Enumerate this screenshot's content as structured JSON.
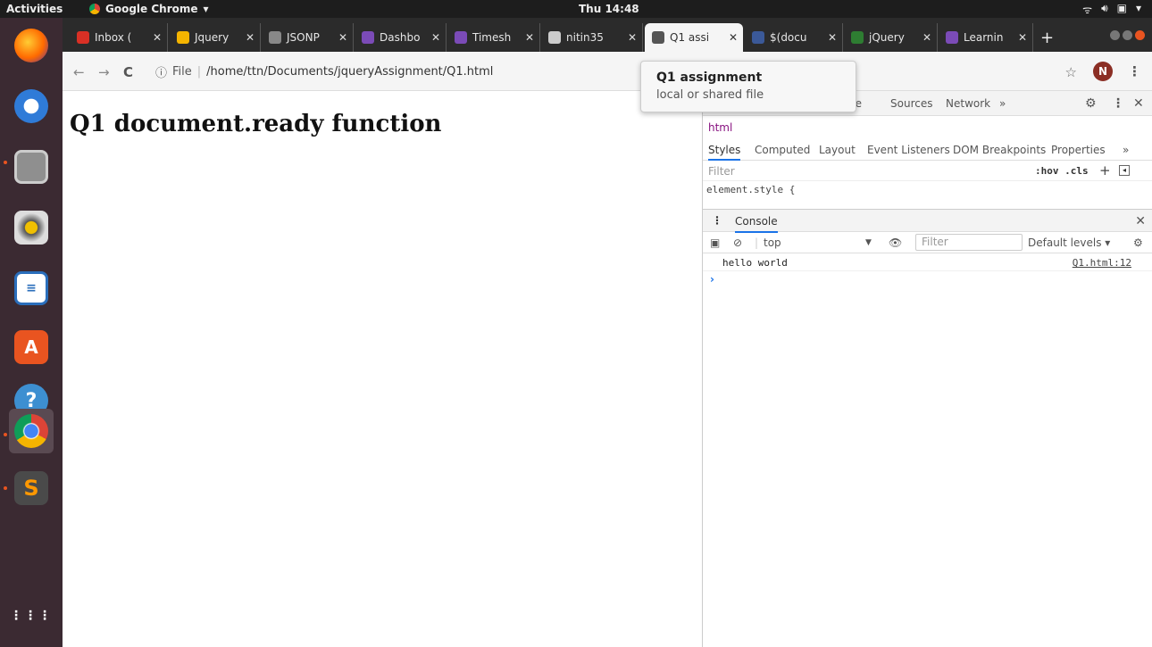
{
  "topbar": {
    "activities": "Activities",
    "app_name": "Google Chrome",
    "clock": "Thu 14:48"
  },
  "browser": {
    "tabs": [
      {
        "label": "Inbox (",
        "color": "#d93025"
      },
      {
        "label": "Jquery",
        "color": "#f4b400"
      },
      {
        "label": "JSONP",
        "color": "#888888"
      },
      {
        "label": "Dashbo",
        "color": "#7b4bb7"
      },
      {
        "label": "Timesh",
        "color": "#7b4bb7"
      },
      {
        "label": "nitin35",
        "color": "#cccccc"
      },
      {
        "label": "Q1 assi",
        "color": "#555555"
      },
      {
        "label": "$(docu",
        "color": "#3b5998"
      },
      {
        "label": "jQuery",
        "color": "#2e7d32"
      },
      {
        "label": "Learnin",
        "color": "#7b4bb7"
      }
    ],
    "new_tab": "+",
    "url_file_label": "File",
    "url": "/home/ttn/Documents/jqueryAssignment/Q1.html",
    "avatar_letter": "N"
  },
  "tooltip": {
    "title": "Q1 assignment",
    "subtitle": "local or shared file"
  },
  "page": {
    "heading": "Q1 document.ready function"
  },
  "devtools": {
    "top_tabs": [
      "ole",
      "Sources",
      "Network",
      "»"
    ],
    "breadcrumb": "html",
    "style_tabs": [
      "Styles",
      "Computed",
      "Layout",
      "Event Listeners",
      "DOM Breakpoints",
      "Properties",
      "»"
    ],
    "filter_placeholder": "Filter",
    "hov_cls": ":hov .cls",
    "element_style": "element.style {",
    "console_label": "Console",
    "context": "top",
    "console_filter": "Filter",
    "levels": "Default levels ▾",
    "log_message": "hello world",
    "log_source": "Q1.html:12",
    "prompt": "›"
  }
}
